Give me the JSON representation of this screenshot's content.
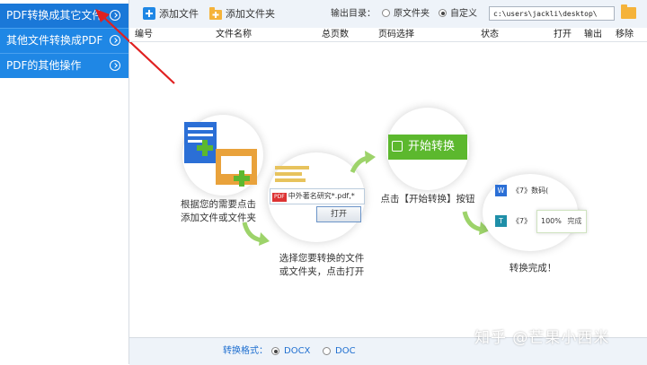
{
  "sidebar": {
    "items": [
      {
        "label": "PDF转换成其它文件"
      },
      {
        "label": "其他文件转换成PDF"
      },
      {
        "label": "PDF的其他操作"
      }
    ]
  },
  "toolbar": {
    "add_file": "添加文件",
    "add_folder": "添加文件夹",
    "output_label": "输出目录：",
    "original_folder": "原文件夹",
    "custom": "自定义",
    "path_value": "c:\\users\\jackli\\desktop\\"
  },
  "table": {
    "headers": [
      "编号",
      "文件名称",
      "总页数",
      "页码选择",
      "状态",
      "打开",
      "输出",
      "移除"
    ]
  },
  "guide": {
    "step1": "根据您的需要点击\n添加文件或文件夹",
    "step2": "选择您要转换的文件\n或文件夹，点击打开",
    "step3": "点击【开始转换】按钮",
    "step4": "转换完成！",
    "start_button": "开始转换",
    "file_pattern": "中外著名研究*.pdf,*",
    "open_button": "打开",
    "doc_item1": "《7》数码(",
    "doc_item2": "《7》",
    "progress": "100%",
    "done": "完成"
  },
  "bottom": {
    "format_label": "转换格式：",
    "options": [
      "DOCX",
      "DOC"
    ]
  },
  "watermark": "知乎 @芒果小西米",
  "colors": {
    "accent": "#1f87e5",
    "green": "#5cb82e",
    "arrow_red": "#e02020"
  }
}
